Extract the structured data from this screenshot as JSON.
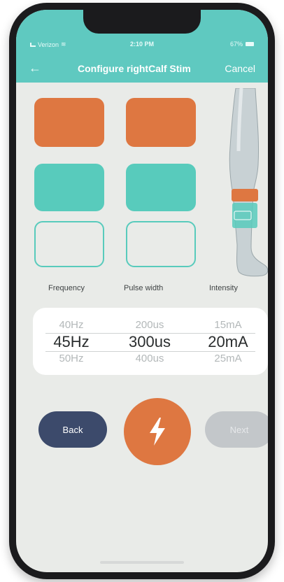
{
  "status_bar": {
    "carrier": "Verizon",
    "time": "2:10 PM",
    "battery": "67%"
  },
  "nav": {
    "back_icon": "back-arrow-icon",
    "title": "Configure rightCalf Stim",
    "cancel_label": "Cancel"
  },
  "electrodes": {
    "colors": {
      "active_orange": "#de7741",
      "active_teal": "#58cbbc",
      "inactive_outline": "#58cbbc"
    }
  },
  "picker": {
    "labels": [
      "Frequency",
      "Pulse width",
      "Intensity"
    ],
    "frequency": {
      "prev": "40Hz",
      "selected": "45Hz",
      "next": "50Hz"
    },
    "pulse_width": {
      "prev": "200us",
      "selected": "300us",
      "next": "400us"
    },
    "intensity": {
      "prev": "15mA",
      "selected": "20mA",
      "next": "25mA"
    }
  },
  "actions": {
    "back_label": "Back",
    "stim_icon": "lightning-bolt-icon",
    "next_label": "Next"
  },
  "colors": {
    "header": "#5fc9c0",
    "accent_orange": "#de7741",
    "back_button": "#3c4a6b",
    "next_button_disabled": "#c3c7ca"
  }
}
